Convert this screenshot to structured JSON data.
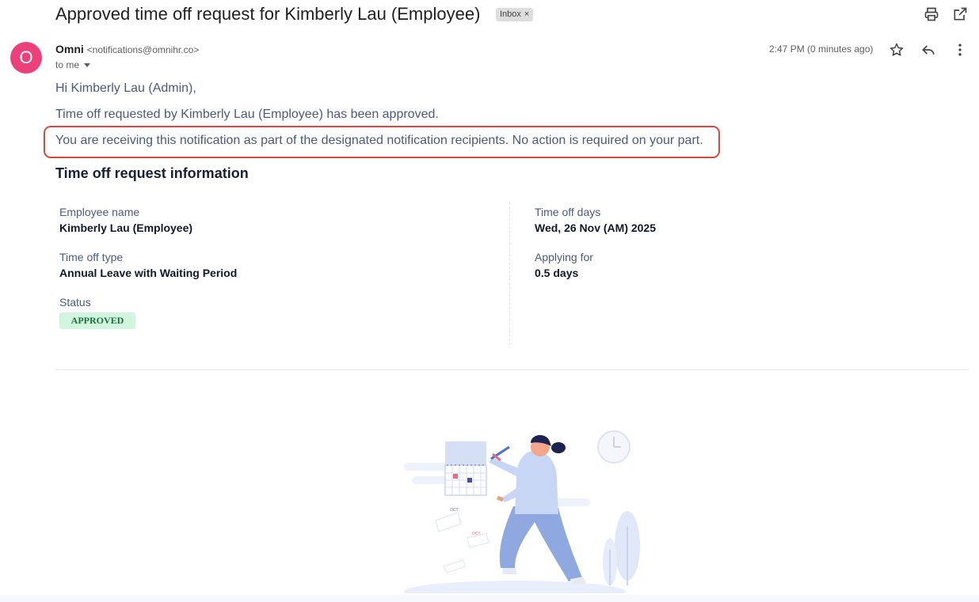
{
  "email": {
    "subject": "Approved time off request for Kimberly Lau (Employee)",
    "label_chip": "Inbox",
    "label_chip_remove": "×",
    "sender_initial": "O",
    "sender_name": "Omni",
    "sender_email": "<notifications@omnihr.co>",
    "recipient": "to me",
    "timestamp": "2:47 PM (0 minutes ago)",
    "colors": {
      "avatar": "#ec407a",
      "highlight_border": "#d94a3d",
      "status_bg": "#d1f5df",
      "status_text": "#1b6e3a"
    }
  },
  "icons": {
    "print": "print-icon",
    "popout": "open-in-new-window-icon",
    "star": "star-icon",
    "reply": "reply-icon",
    "more": "more-vertical-icon"
  },
  "content": {
    "greeting": "Hi Kimberly Lau (Admin),",
    "approved_line": "Time off requested by Kimberly Lau (Employee) has been approved.",
    "notice_line": "You are receiving this notification as part of the designated notification recipients. No action is required on your part.",
    "section_title": "Time off request information",
    "fields": {
      "employee_name": {
        "label": "Employee name",
        "value": "Kimberly Lau (Employee)"
      },
      "time_off_type": {
        "label": "Time off type",
        "value": "Annual Leave with Waiting Period"
      },
      "status": {
        "label": "Status",
        "value": "APPROVED"
      },
      "time_off_days": {
        "label": "Time off days",
        "value": "Wed, 26 Nov (AM) 2025"
      },
      "applying_for": {
        "label": "Applying for",
        "value": "0.5 days"
      }
    },
    "illustration": {
      "calendar_label_1": "OCT",
      "calendar_label_2": "OCT"
    }
  }
}
